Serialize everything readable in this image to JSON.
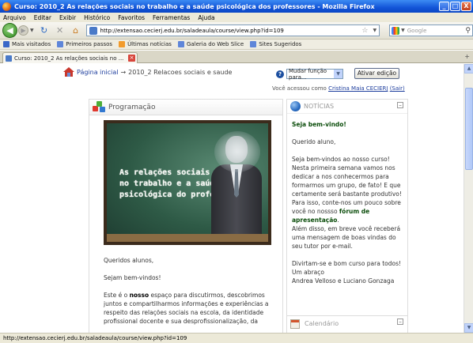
{
  "window": {
    "title": "Curso: 2010_2 As relações sociais no trabalho e a saúde psicológica dos professores - Mozilla Firefox",
    "min": "_",
    "max": "□",
    "close": "X"
  },
  "menu": [
    "Arquivo",
    "Editar",
    "Exibir",
    "Histórico",
    "Favoritos",
    "Ferramentas",
    "Ajuda"
  ],
  "nav": {
    "url": "http://extensao.cecierj.edu.br/saladeaula/course/view.php?id=109",
    "search_placeholder": "Google"
  },
  "bookmarks": [
    {
      "label": "Mais visitados",
      "color": "#3a67c7"
    },
    {
      "label": "Primeiros passos",
      "color": "#5f86d9"
    },
    {
      "label": "Últimas notícias",
      "color": "#f29b2c"
    },
    {
      "label": "Galeria do Web Slice",
      "color": "#5f86d9"
    },
    {
      "label": "Sites Sugeridos",
      "color": "#5f86d9"
    }
  ],
  "tab": {
    "label": "Curso: 2010_2 As relações sociais no ..."
  },
  "page": {
    "breadcrumb_home": "Página inicial",
    "breadcrumb_sep": "→",
    "breadcrumb_current": "2010_2 Relacoes sociais e saude",
    "role_select": "Mudar função para...",
    "edit_button": "Ativar edição",
    "logged_prefix": "Você acessou como",
    "logged_user": "Cristina Maia CECIERJ",
    "logout": "(Sair)"
  },
  "main": {
    "heading": "Programação",
    "banner_lines": [
      "As relações sociais",
      "no trabalho e a saúde",
      "psicológica do professor"
    ],
    "greeting": "Queridos alunos,",
    "welcome": "Sejam bem-vindos!",
    "para_before": "Este é o ",
    "para_bold": "nosso",
    "para_after": " espaço para discutirmos, descobrimos juntos e compartilharmos informações e experiências a respeito das relações sociais na escola, da identidade profissional docente e sua desprofissionalização, da"
  },
  "news": {
    "heading": "NOTÍCIAS",
    "title": "Seja bem-vindo!",
    "salutation": "Querido aluno,",
    "p1": "Seja bem-vindos ao nosso curso! Nesta primeira semana vamos nos dedicar a nos conhecermos para formarmos um grupo, de fato! E que certamente será bastante produtivo!",
    "p2_a": "Para isso, conte-nos um pouco sobre você no nossso ",
    "p2_link": "fórum de apresentação",
    "p2_b": ".",
    "p3": "Além disso, em breve você receberá uma mensagem de boas vindas do seu tutor por e-mail.",
    "p4": "Divirtam-se e bom curso para todos!",
    "p5": "Um abraço",
    "p6": "Andrea Velloso e Luciano Gonzaga"
  },
  "calendar": {
    "heading": "Calendário"
  },
  "status": "http://extensao.cecierj.edu.br/saladeaula/course/view.php?id=109"
}
